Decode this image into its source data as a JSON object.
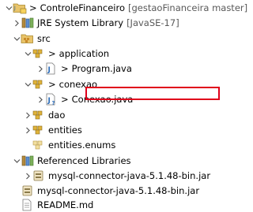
{
  "tree": {
    "project": {
      "prefix": ">",
      "name": "ControleFinanceiro",
      "decoration": "[gestaoFinanceira master]"
    },
    "jre": {
      "name": "JRE System Library",
      "decoration": "[JavaSE-17]"
    },
    "src": {
      "name": "src"
    },
    "application": {
      "prefix": ">",
      "name": "application"
    },
    "program": {
      "prefix": ">",
      "name": "Program.java"
    },
    "conexao_pkg": {
      "prefix": ">",
      "name": "conexao"
    },
    "conexao_java": {
      "prefix": ">",
      "name": "Conexao.java"
    },
    "dao": {
      "name": "dao"
    },
    "entities": {
      "name": "entities"
    },
    "entities_enums": {
      "name": "entities.enums"
    },
    "ref_libs": {
      "name": "Referenced Libraries"
    },
    "mysql_ref": {
      "name": "mysql-connector-java-5.1.48-bin.jar"
    },
    "mysql_jar": {
      "name": "mysql-connector-java-5.1.48-bin.jar"
    },
    "readme": {
      "name": "README.md"
    }
  },
  "colors": {
    "highlight_border": "#e0001a",
    "decoration_text": "#595959",
    "package_icon": "#c9a227",
    "java_icon": "#2a6bb8"
  }
}
